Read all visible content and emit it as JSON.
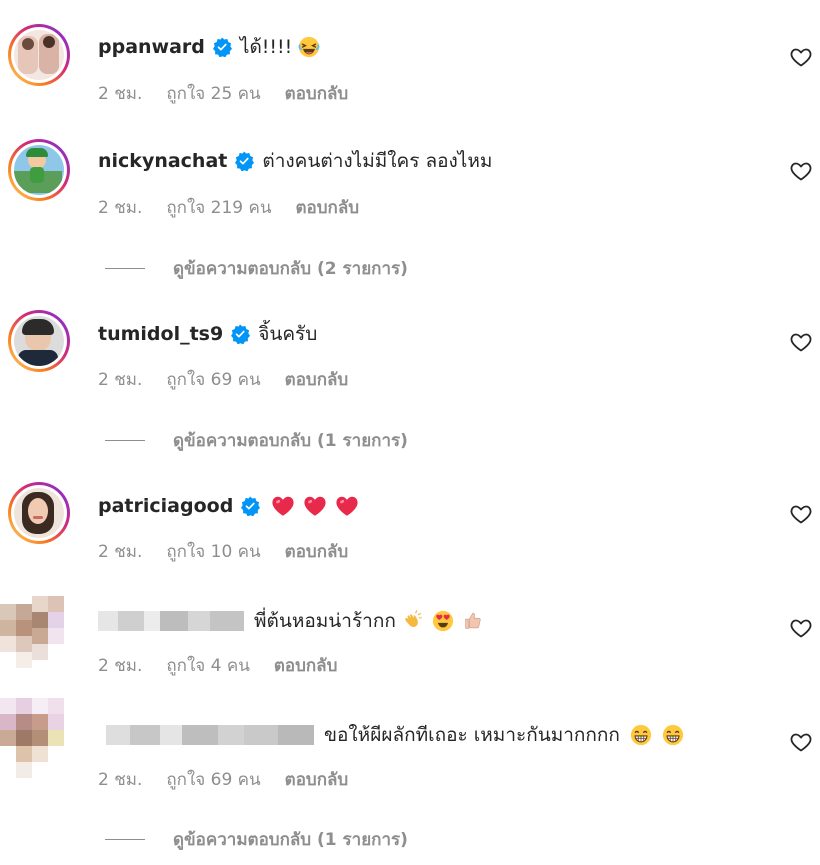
{
  "comments": [
    {
      "username": "ppanward",
      "text": "ได้!!!!",
      "emoji": [
        "laughing-emoji"
      ],
      "time": "2 ชม.",
      "likes": "ถูกใจ 25 คน",
      "reply": "ตอบกลับ"
    },
    {
      "username": "nickynachat",
      "text": "ต่างคนต่างไม่มีใคร ลองไหม",
      "emoji": [],
      "time": "2 ชม.",
      "likes": "ถูกใจ 219 คน",
      "reply": "ตอบกลับ",
      "view_replies": "ดูข้อความตอบกลับ (2 รายการ)"
    },
    {
      "username": "tumidol_ts9",
      "text": "จิ้นครับ",
      "emoji": [],
      "time": "2 ชม.",
      "likes": "ถูกใจ 69 คน",
      "reply": "ตอบกลับ",
      "view_replies": "ดูข้อความตอบกลับ (1 รายการ)"
    },
    {
      "username": "patriciagood",
      "text": "",
      "emoji": [
        "heart-emoji",
        "heart-emoji",
        "heart-emoji"
      ],
      "time": "2 ชม.",
      "likes": "ถูกใจ 10 คน",
      "reply": "ตอบกลับ"
    },
    {
      "username": "",
      "text": "พี่ต้นหอมน่าร้ากก",
      "emoji": [
        "clapping-emoji",
        "heart-eyes-emoji",
        "thumbs-up-emoji"
      ],
      "time": "2 ชม.",
      "likes": "ถูกใจ 4 คน",
      "reply": "ตอบกลับ"
    },
    {
      "username": "",
      "text": "ขอให้ผีผลักทีเถอะ เหมาะกันมากกกก",
      "emoji": [
        "grin-emoji",
        "grin-emoji"
      ],
      "time": "2 ชม.",
      "likes": "ถูกใจ 69 คน",
      "reply": "ตอบกลับ",
      "view_replies": "ดูข้อความตอบกลับ (1 รายการ)"
    }
  ],
  "colors": {
    "text": "#262626",
    "secondary": "#8e8e8e",
    "verified": "#0095f6",
    "heart_emoji": "#e8294a"
  }
}
